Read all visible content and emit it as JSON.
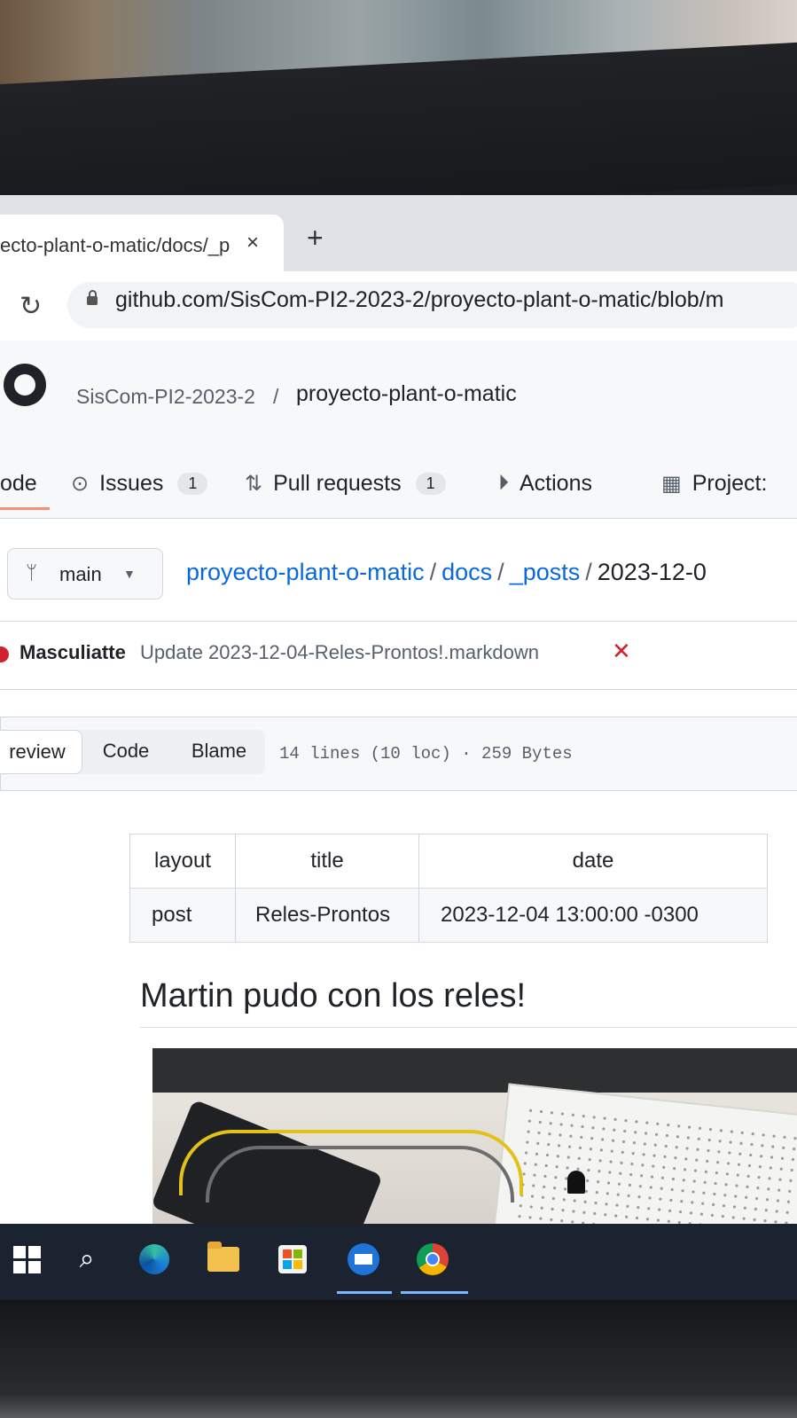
{
  "browser": {
    "tab_title": "ecto-plant-o-matic/docs/_p",
    "tab_close": "×",
    "new_tab": "+",
    "url": "github.com/SisCom-PI2-2023-2/proyecto-plant-o-matic/blob/m"
  },
  "repo": {
    "owner": "SisCom-PI2-2023-2",
    "separator": "/",
    "name": "proyecto-plant-o-matic",
    "nav": {
      "code": "ode",
      "issues": "Issues",
      "issues_count": "1",
      "pulls": "Pull requests",
      "pulls_count": "1",
      "actions": "Actions",
      "projects": "Project:"
    }
  },
  "file": {
    "branch": "main",
    "breadcrumb": [
      "proyecto-plant-o-matic",
      "docs",
      "_posts",
      "2023-12-0"
    ],
    "commit_author": "Masculiatte",
    "commit_message": "Update 2023-12-04-Reles-Prontos!.markdown",
    "commit_status": "✕",
    "view_tabs": [
      "review",
      "Code",
      "Blame"
    ],
    "info": "14 lines (10 loc) · 259 Bytes"
  },
  "front_matter": {
    "headers": [
      "layout",
      "title",
      "date"
    ],
    "row": [
      "post",
      "Reles-Prontos",
      "2023-12-04 13:00:00 -0300"
    ]
  },
  "content": {
    "heading": "Martin pudo con los reles!"
  },
  "icons": {
    "reload": "reload-icon",
    "lock": "lock-icon",
    "issues": "issue-opened-icon",
    "pulls": "git-pull-request-icon",
    "actions": "play-icon",
    "projects": "table-icon",
    "branch": "git-branch-icon"
  },
  "colors": {
    "link": "#0969da",
    "fail": "#cf222e",
    "tab_underline": "#fd8c73",
    "taskbar": "#1c2330"
  }
}
